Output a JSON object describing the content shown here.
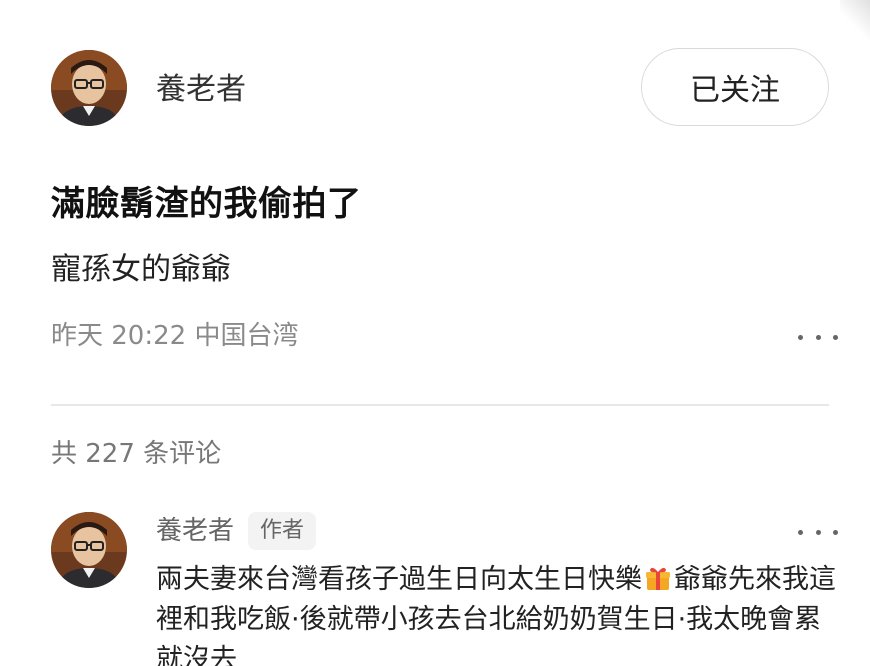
{
  "post": {
    "author_name": "養老者",
    "follow_label": "已关注",
    "title": "滿臉鬍渣的我偷拍了",
    "body": "寵孫女的爺爺",
    "meta": "昨天 20:22 中国台湾"
  },
  "comments_section": {
    "count_text": "共 227 条评论"
  },
  "comment": {
    "author_name": "養老者",
    "badge": "作者",
    "text_part1": "兩夫妻來台灣看孩子過生日向太生日快樂",
    "gift_icon": "gift-emoji-icon",
    "text_part2": "爺爺先來我這裡和我吃飯·後就帶小孩去台北給奶奶賀生日·我太晚會累就沒去"
  },
  "icons": {
    "avatar": "avatar-icon",
    "more": "more-icon"
  },
  "colors": {
    "gift_orange": "#f5a623",
    "gift_red": "#e8453c"
  }
}
